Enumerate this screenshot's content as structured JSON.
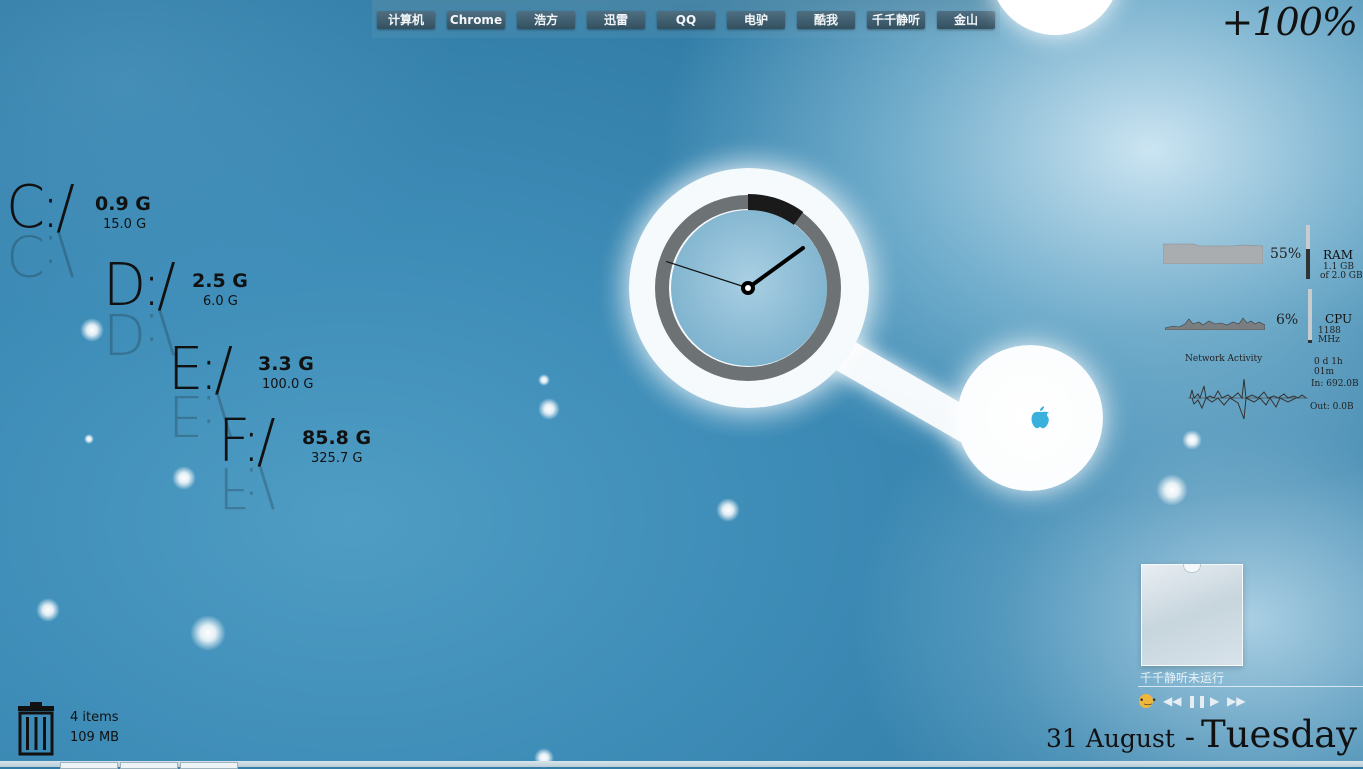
{
  "launcher": {
    "items": [
      "计算机",
      "Chrome",
      "浩方",
      "迅雷",
      "QQ",
      "电驴",
      "酷我",
      "千千静听",
      "金山"
    ]
  },
  "battery": {
    "level_text": "+100%"
  },
  "drives": [
    {
      "letter": "C:/",
      "free": "0.9 G",
      "total": "15.0 G"
    },
    {
      "letter": "D:/",
      "free": "2.5 G",
      "total": "6.0 G"
    },
    {
      "letter": "E:/",
      "free": "3.3 G",
      "total": "100.0 G"
    },
    {
      "letter": "F:/",
      "free": "85.8 G",
      "total": "325.7 G"
    }
  ],
  "clock": {
    "hour": 1,
    "minute": 48,
    "seconds_arc_fraction": 0.1
  },
  "system": {
    "ram": {
      "label": "RAM",
      "percent": "55%",
      "used": "1.1 GB",
      "total": "of 2.0 GB",
      "fraction": 0.55
    },
    "cpu": {
      "label": "CPU",
      "percent": "6%",
      "freq": "1188 MHz",
      "fraction": 0.06
    },
    "network": {
      "label": "Network Activity",
      "uptime": "0 d 1h 01m",
      "in": "In: 692.0B",
      "out": "Out: 0.0B"
    }
  },
  "player": {
    "status": "千千静听未运行",
    "controls": [
      "smiley-icon",
      "rewind-icon",
      "pause-icon",
      "play-icon",
      "fast-forward-icon"
    ]
  },
  "date": {
    "day_month": "31 August",
    "separator": "-",
    "weekday": "Tuesday"
  },
  "recycle_bin": {
    "items": "4 items",
    "size": "109 MB"
  },
  "colors": {
    "accent_bg": "#3e8db8",
    "text_dark": "#111111",
    "widget_white": "#ffffff",
    "button": "#3f5e70"
  }
}
